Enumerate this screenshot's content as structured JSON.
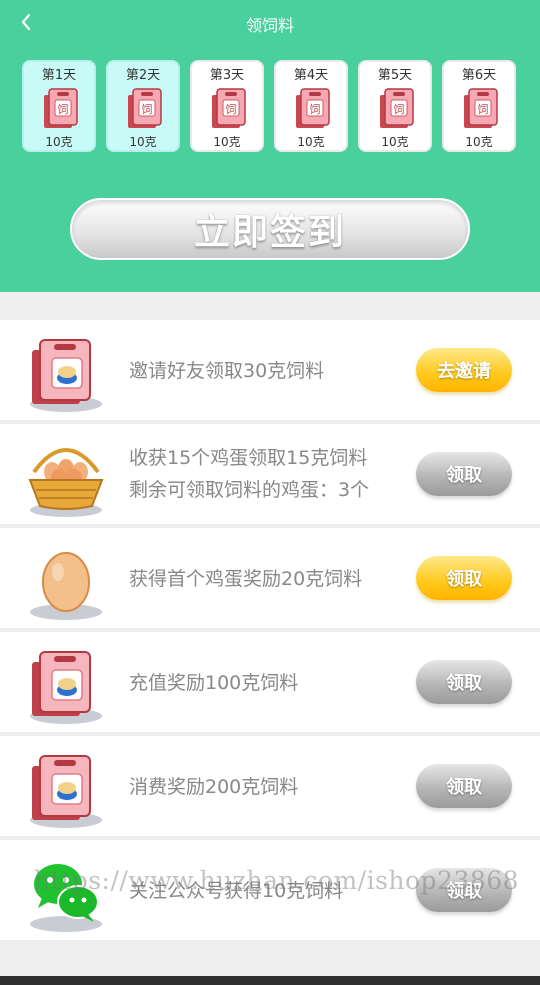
{
  "header": {
    "title": "领饲料",
    "bg_color": "#49d09c",
    "back_icon": "chevron-left-icon"
  },
  "checkin": {
    "days": [
      {
        "label": "第1天",
        "amount": "10克",
        "claimed": true
      },
      {
        "label": "第2天",
        "amount": "10克",
        "claimed": true
      },
      {
        "label": "第3天",
        "amount": "10克",
        "claimed": false
      },
      {
        "label": "第4天",
        "amount": "10克",
        "claimed": false
      },
      {
        "label": "第5天",
        "amount": "10克",
        "claimed": false
      },
      {
        "label": "第6天",
        "amount": "10克",
        "claimed": false
      }
    ],
    "sign_button": "立即签到"
  },
  "tasks": [
    {
      "icon": "feed-bag-icon",
      "line1": "邀请好友领取30克饲料",
      "line2": "",
      "button": "去邀请",
      "button_style": "yellow"
    },
    {
      "icon": "egg-basket-icon",
      "line1": "收获15个鸡蛋领取15克饲料",
      "line2": "剩余可领取饲料的鸡蛋：3个",
      "button": "领取",
      "button_style": "gray"
    },
    {
      "icon": "egg-icon",
      "line1": "获得首个鸡蛋奖励20克饲料",
      "line2": "",
      "button": "领取",
      "button_style": "yellow"
    },
    {
      "icon": "feed-bag-icon",
      "line1": "充值奖励100克饲料",
      "line2": "",
      "button": "领取",
      "button_style": "gray"
    },
    {
      "icon": "feed-bag-icon",
      "line1": "消费奖励200克饲料",
      "line2": "",
      "button": "领取",
      "button_style": "gray"
    },
    {
      "icon": "wechat-icon",
      "line1": "关注公众号获得10克饲料",
      "line2": "",
      "button": "领取",
      "button_style": "gray"
    }
  ],
  "watermark": "https://www.huzhan.com/ishop23868",
  "colors": {
    "accent_yellow": "#ffc91c",
    "button_gray": "#b3b3b3",
    "claimed_day": "#c8fbf7"
  }
}
